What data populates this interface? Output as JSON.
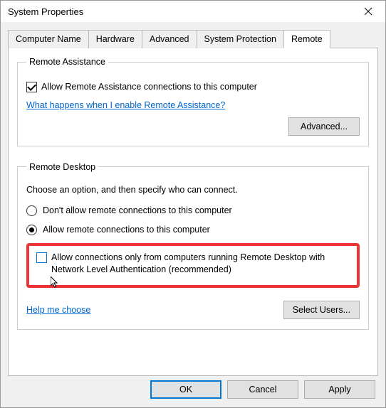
{
  "window": {
    "title": "System Properties"
  },
  "tabs": {
    "computer_name": "Computer Name",
    "hardware": "Hardware",
    "advanced": "Advanced",
    "system_protection": "System Protection",
    "remote": "Remote"
  },
  "remote_assistance": {
    "legend": "Remote Assistance",
    "allow_label": "Allow Remote Assistance connections to this computer",
    "help_link": "What happens when I enable Remote Assistance?",
    "advanced_button": "Advanced..."
  },
  "remote_desktop": {
    "legend": "Remote Desktop",
    "choose_text": "Choose an option, and then specify who can connect.",
    "option_disallow": "Don't allow remote connections to this computer",
    "option_allow": "Allow remote connections to this computer",
    "nla_checkbox": "Allow connections only from computers running Remote Desktop with Network Level Authentication (recommended)",
    "help_link": "Help me choose",
    "select_users_button": "Select Users..."
  },
  "buttons": {
    "ok": "OK",
    "cancel": "Cancel",
    "apply": "Apply"
  }
}
